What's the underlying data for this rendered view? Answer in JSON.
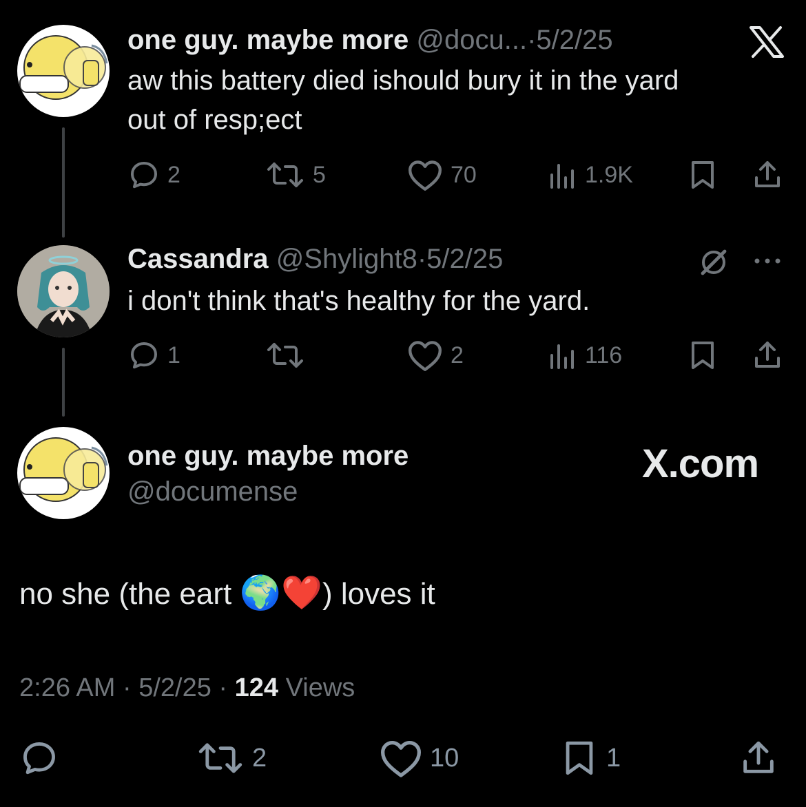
{
  "thread": [
    {
      "display_name": "one guy. maybe more",
      "handle": "@docu...",
      "date": "5/2/25",
      "text_line1": "aw this battery died ishould bury it in the yard",
      "text_line2": "out of resp;ect",
      "replies": "2",
      "reposts": "5",
      "likes": "70",
      "views": "1.9K"
    },
    {
      "display_name": "Cassandra",
      "handle": "@Shylight8",
      "date": "5/2/25",
      "text": "i don't think that's healthy for the yard.",
      "replies": "1",
      "reposts": "",
      "likes": "2",
      "views": "116"
    }
  ],
  "main_post": {
    "display_name": "one guy. maybe more",
    "handle": "@documense",
    "brand": "X.com",
    "text_before": "no she (the eart ",
    "emoji": "🌍❤️",
    "text_after": ") loves it",
    "time": "2:26 AM",
    "date": "5/2/25",
    "views_count": "124",
    "views_label": "Views",
    "reposts": "2",
    "likes": "10",
    "bookmarks": "1"
  },
  "separator": "·",
  "colors": {
    "background": "#000000",
    "text": "#e7e9ea",
    "muted": "#71767b",
    "avatar_yellow": "#f4e26a"
  }
}
